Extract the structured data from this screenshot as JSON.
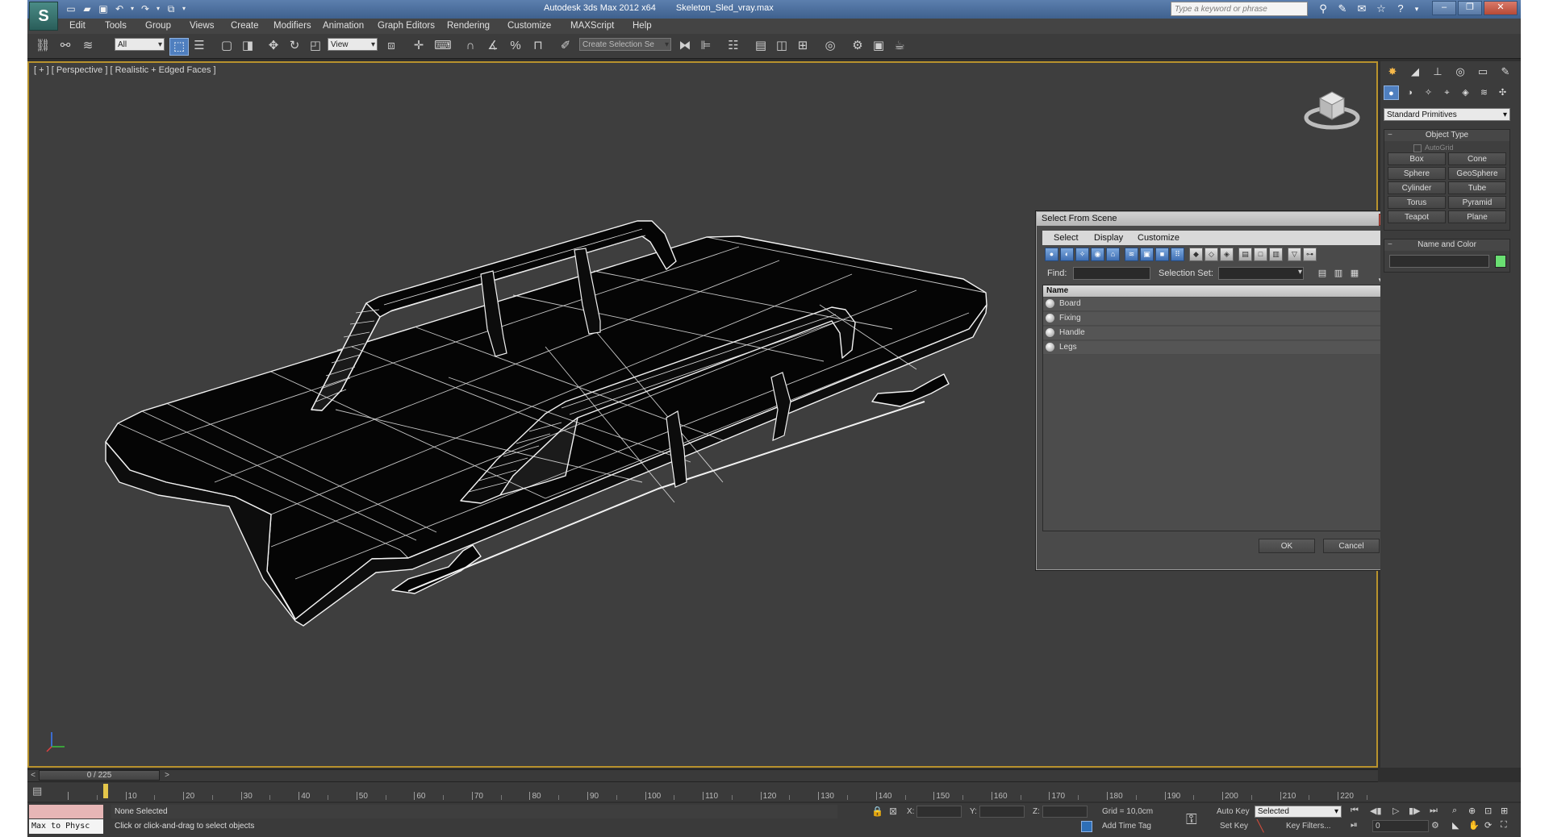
{
  "window": {
    "title_app": "Autodesk 3ds Max  2012 x64",
    "title_file": "Skeleton_Sled_vray.max",
    "search_placeholder": "Type a keyword or phrase",
    "logo": "S"
  },
  "menu": [
    "Edit",
    "Tools",
    "Group",
    "Views",
    "Create",
    "Modifiers",
    "Animation",
    "Graph Editors",
    "Rendering",
    "Customize",
    "MAXScript",
    "Help"
  ],
  "toolbar": {
    "selection_filter": "All",
    "ref_coord": "View",
    "named_selection": "Create Selection Se"
  },
  "viewport": {
    "label": "[ + ] [ Perspective ] [ Realistic + Edged Faces ]"
  },
  "dialog": {
    "title": "Select From Scene",
    "menu": [
      "Select",
      "Display",
      "Customize"
    ],
    "find_label": "Find:",
    "selection_set_label": "Selection Set:",
    "column_name": "Name",
    "items": [
      "Board",
      "Fixing",
      "Handle",
      "Legs"
    ],
    "ok_label": "OK",
    "cancel_label": "Cancel"
  },
  "command_panel": {
    "category": "Standard Primitives",
    "object_type_title": "Object Type",
    "autogrid_label": "AutoGrid",
    "buttons": [
      "Box",
      "Cone",
      "Sphere",
      "GeoSphere",
      "Cylinder",
      "Tube",
      "Torus",
      "Pyramid",
      "Teapot",
      "Plane"
    ],
    "name_color_title": "Name and Color",
    "object_color": "#6adf72"
  },
  "timeline": {
    "frame_display": "0 / 225",
    "ticks": [
      10,
      20,
      30,
      40,
      50,
      60,
      70,
      80,
      90,
      100,
      110,
      120,
      130,
      140,
      150,
      160,
      170,
      180,
      190,
      200,
      210,
      220
    ],
    "max_frame": 225
  },
  "status": {
    "maxscript_text": "Max to Physc",
    "selection_status": "None Selected",
    "prompt": "Click or click-and-drag to select objects",
    "x_label": "X:",
    "y_label": "Y:",
    "z_label": "Z:",
    "grid": "Grid = 10,0cm",
    "add_time_tag": "Add Time Tag",
    "auto_key": "Auto Key",
    "set_key": "Set Key",
    "key_mode": "Selected",
    "key_filters": "Key Filters...",
    "current_frame": "0"
  },
  "colors": {
    "viewport_bg": "#3e3e3e",
    "active_border": "#b8922d",
    "accent": "#4f7fbf",
    "wire": "#f0f0f0",
    "sled_fill": "#050505"
  }
}
